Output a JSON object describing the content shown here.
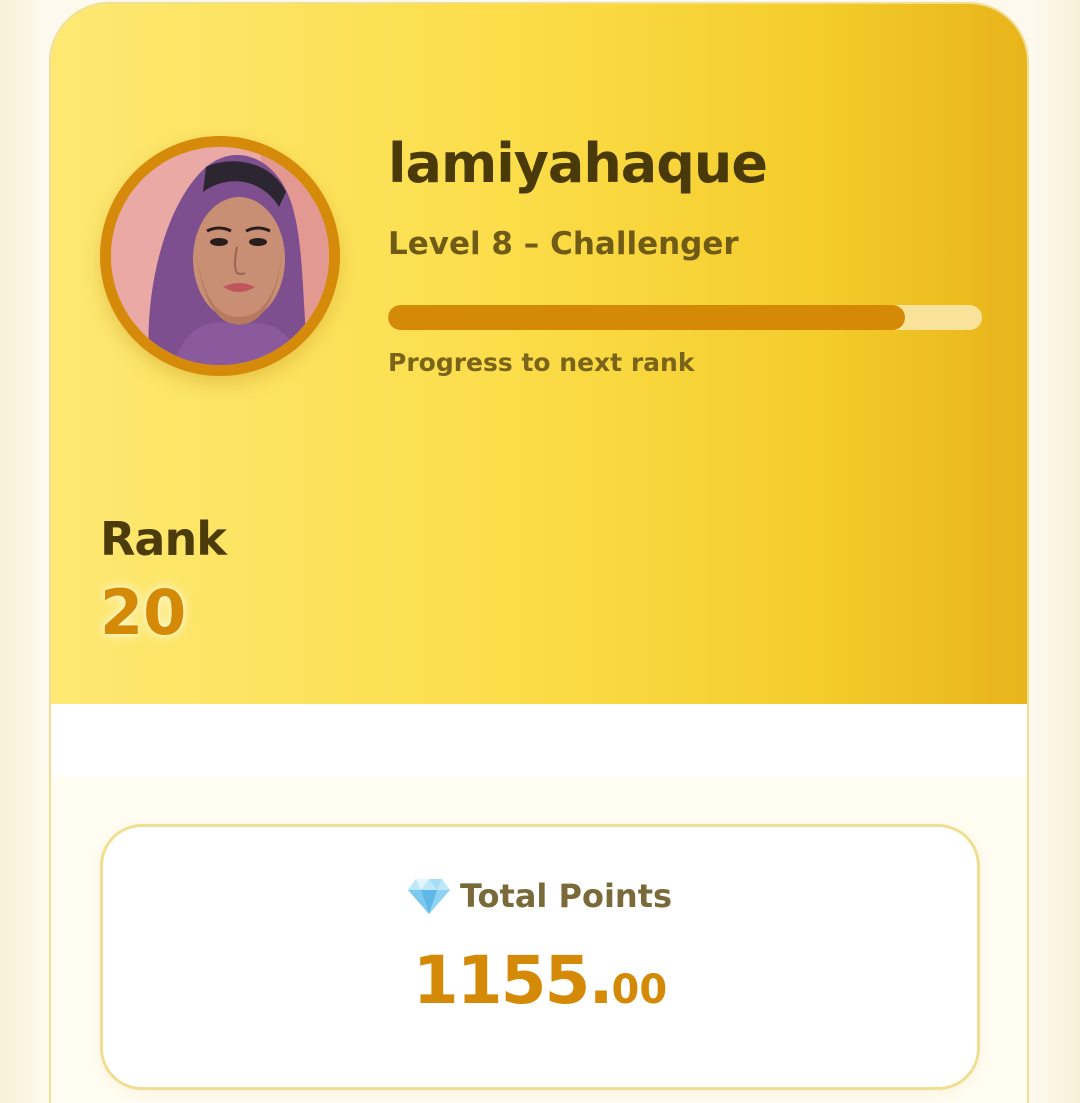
{
  "profile": {
    "username": "lamiyahaque",
    "level_text": "Level 8 – Challenger",
    "progress_fraction": 0.87,
    "progress_label": "Progress to next rank",
    "avatar_alt": "profile photo"
  },
  "rank": {
    "label": "Rank",
    "value": "20"
  },
  "points": {
    "icon": "gem-icon",
    "label": "Total Points",
    "value_int": "1155.",
    "value_dec": "00"
  },
  "colors": {
    "accent": "#d48a06",
    "hero_start": "#fde873",
    "hero_end": "#e8b41b",
    "text_dark": "#4a3a0a"
  }
}
